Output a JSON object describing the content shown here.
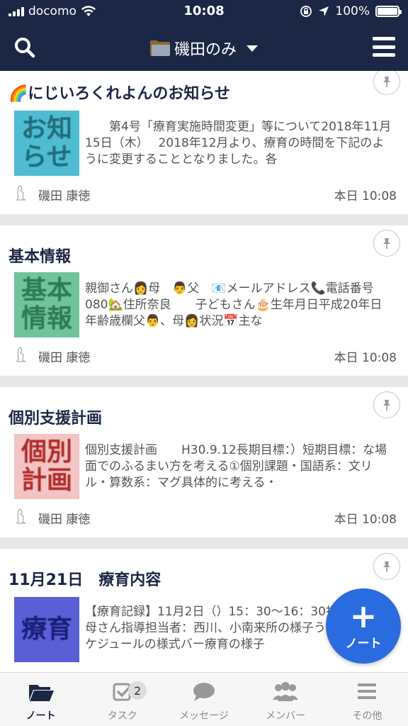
{
  "status_bar": {
    "carrier": "docomo",
    "time": "10:08",
    "battery": "100%"
  },
  "nav": {
    "title": "磯田のみ"
  },
  "cards": [
    {
      "title_emoji": "🌈",
      "title": "にじいろくれよんのお知らせ",
      "thumb_text": "お知\nらせ",
      "thumb_bg": "#4fbcd1",
      "thumb_fg": "#1f6d7a",
      "excerpt": "　　第4号「療育実施時間変更」等について2018年11月15日（木）　 2018年12月より、療育の時間を下記のように変更することとなりました。各",
      "author": "磯田 康徳",
      "time": "本日 10:08"
    },
    {
      "title_emoji": "",
      "title": "基本情報",
      "thumb_text": "基本\n情報",
      "thumb_bg": "#6fc49a",
      "thumb_fg": "#2e7a55",
      "excerpt": "親御さん👩母　👨父　📧メールアドレス📞電話番号080🏡住所奈良　　子どもさん🎂生年月日平成20年日年齢歳欄父👨、母👩状況📅主な",
      "author": "磯田 康徳",
      "time": "本日 10:08"
    },
    {
      "title_emoji": "",
      "title": "個別支援計画",
      "thumb_text": "個別\n計画",
      "thumb_bg": "#f2c4c4",
      "thumb_fg": "#b02a2a",
      "excerpt": "個別支援計画　　H30.9.12長期目標：）短期目標：な場面でのふるまい方を考える①個別課題・国語系：文リル・算数系：マグ具体的に考える・",
      "author": "磯田 康徳",
      "time": "本日 10:08"
    },
    {
      "title_emoji": "",
      "title": "11月21日　療育内容",
      "thumb_text": "療育",
      "thumb_bg": "#5b5fd6",
      "thumb_fg": "#1a1f7a",
      "excerpt": "【療育記録】11月2日（）15：30〜16：30担当者：お母さん指導担当者：西川、小南来所の様子うす久しぶスケジュールの様式バー療育の様子",
      "author": "",
      "time": ""
    }
  ],
  "fab": {
    "label": "ノート"
  },
  "tabs": [
    {
      "label": "ノート",
      "icon": "folder-icon"
    },
    {
      "label": "タスク",
      "icon": "check-icon",
      "badge": "2"
    },
    {
      "label": "メッセージ",
      "icon": "speech-bubble-icon"
    },
    {
      "label": "メンバー",
      "icon": "members-icon"
    },
    {
      "label": "その他",
      "icon": "menu-icon"
    }
  ]
}
